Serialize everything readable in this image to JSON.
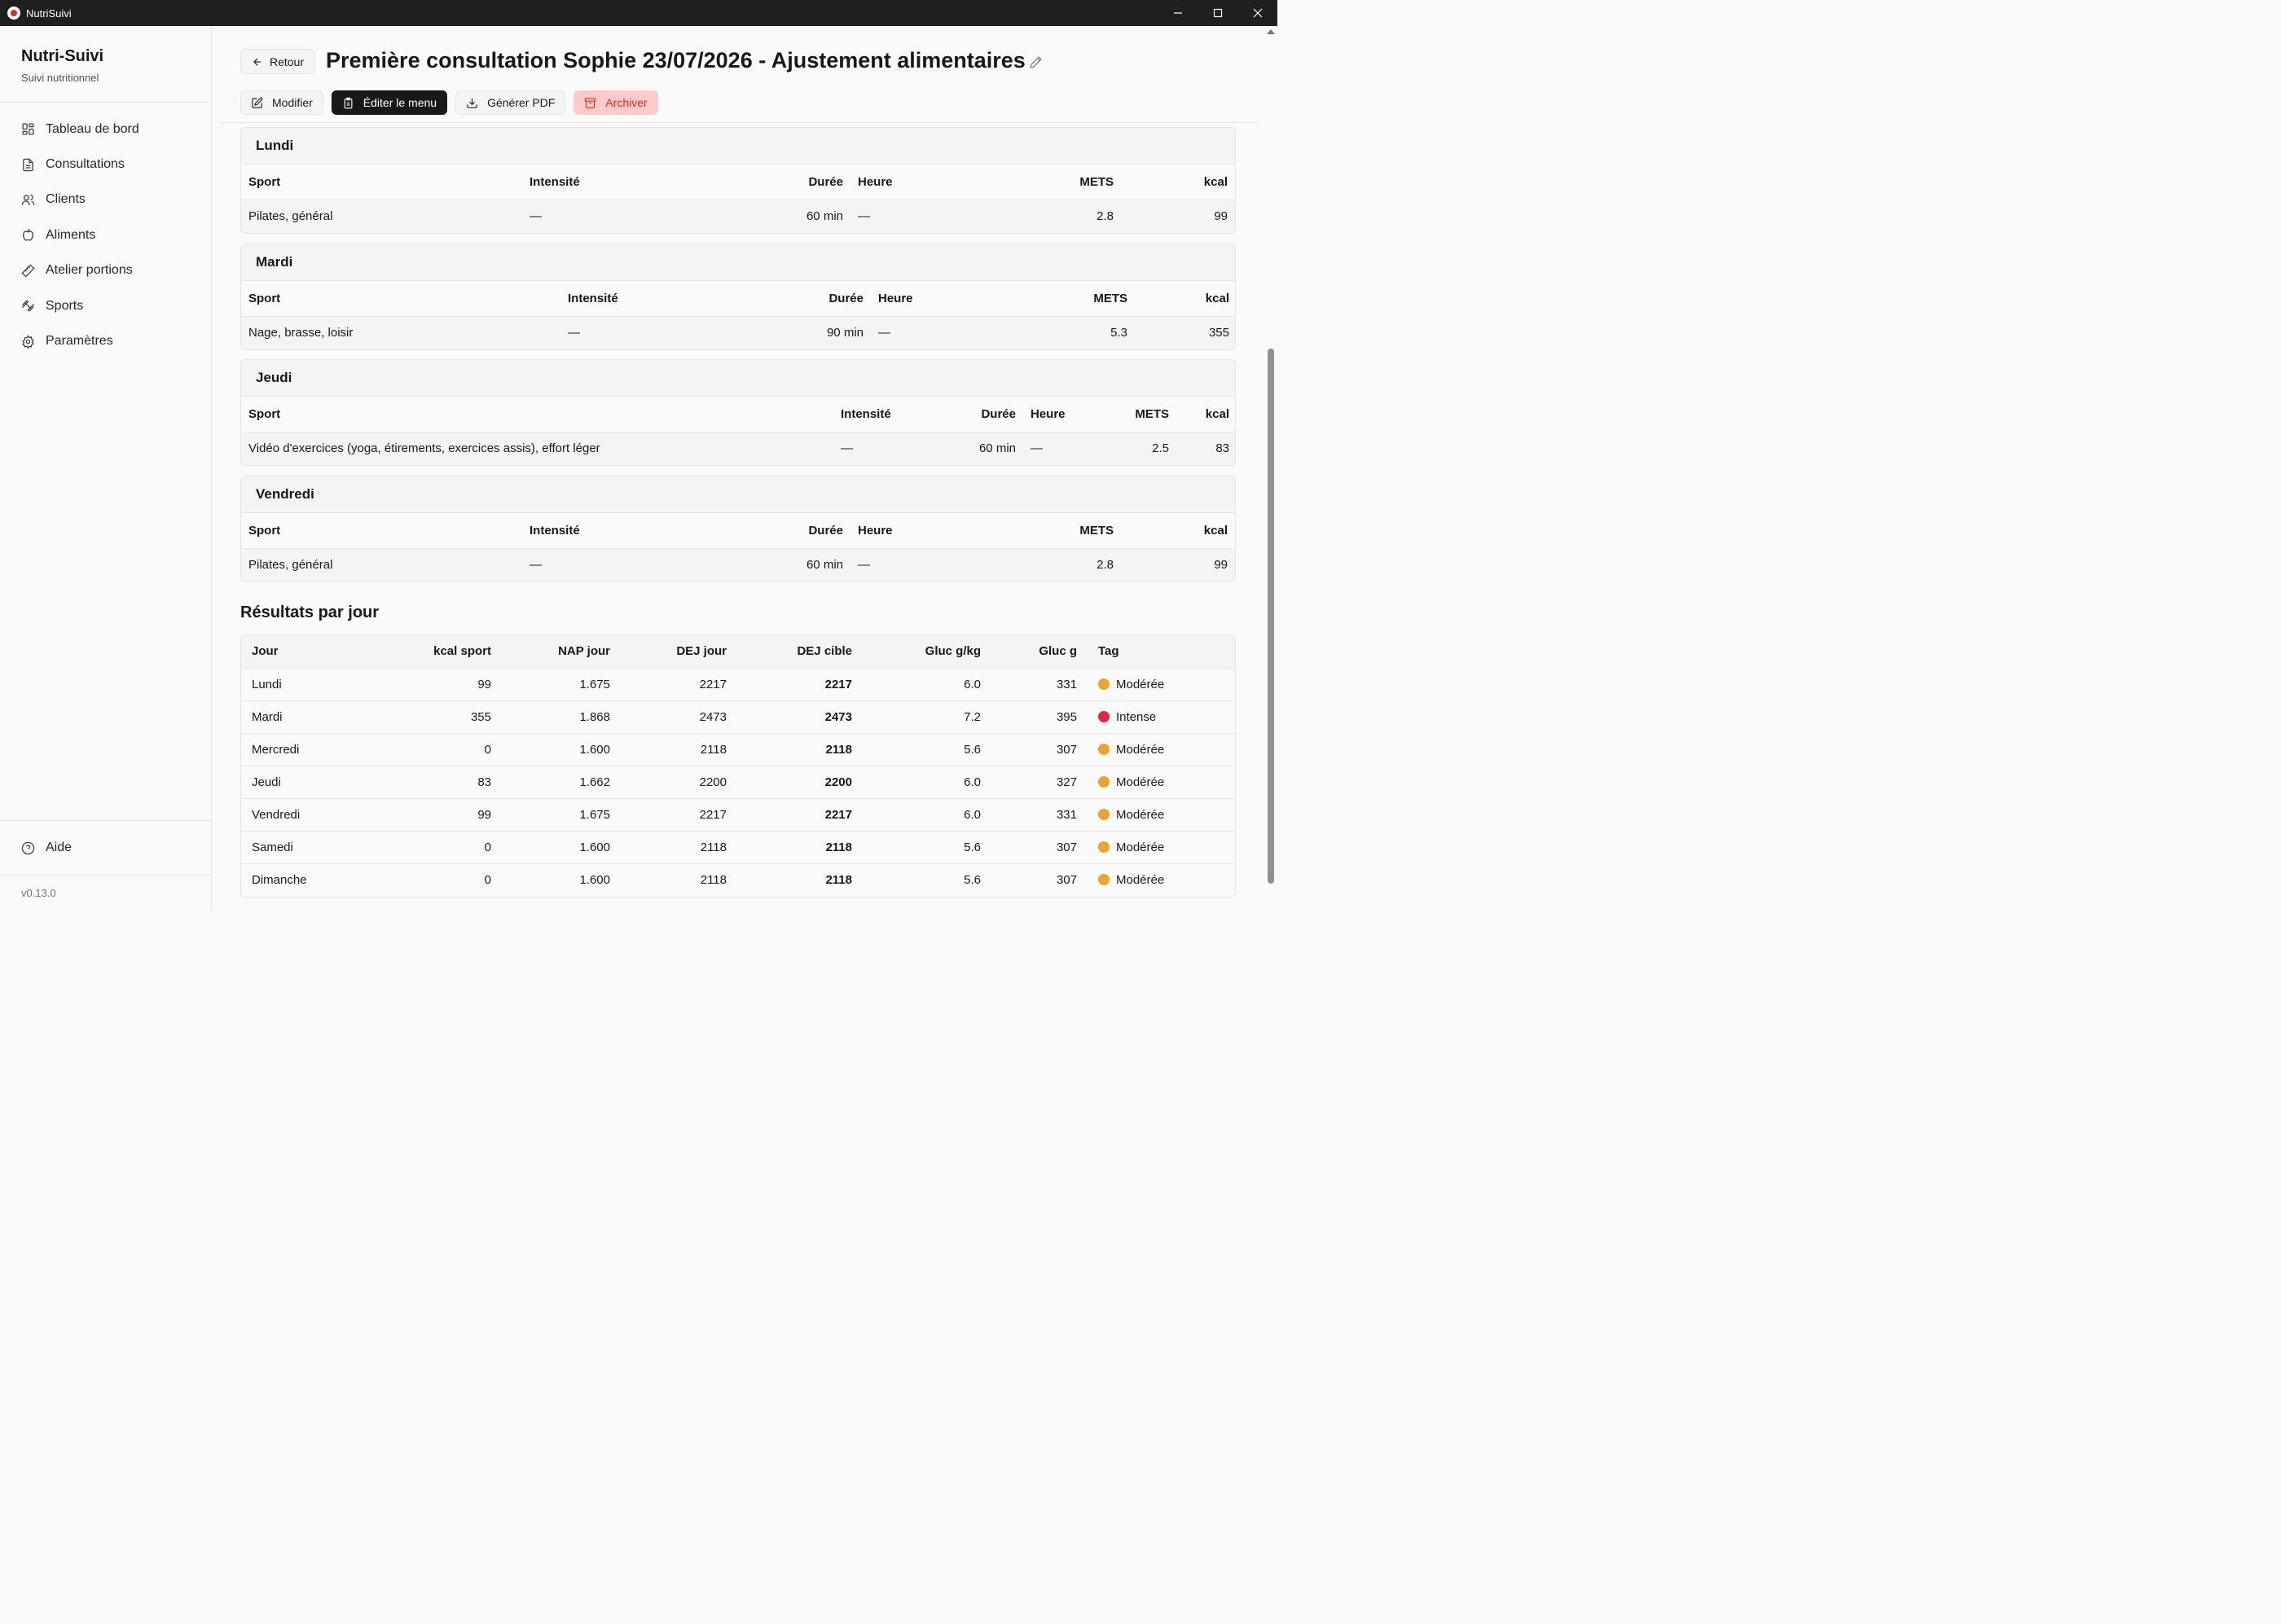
{
  "window": {
    "title": "NutriSuivi"
  },
  "sidebar": {
    "brand": "Nutri-Suivi",
    "subtitle": "Suivi nutritionnel",
    "items": [
      {
        "label": "Tableau de bord",
        "icon": "dashboard-icon"
      },
      {
        "label": "Consultations",
        "icon": "document-icon"
      },
      {
        "label": "Clients",
        "icon": "users-icon"
      },
      {
        "label": "Aliments",
        "icon": "apple-icon"
      },
      {
        "label": "Atelier portions",
        "icon": "ruler-icon"
      },
      {
        "label": "Sports",
        "icon": "dumbbell-icon"
      },
      {
        "label": "Paramètres",
        "icon": "gear-icon"
      }
    ],
    "help": "Aide",
    "version": "v0.13.0"
  },
  "header": {
    "back": "Retour",
    "title": "Première consultation Sophie 23/07/2026 - Ajustement alimentaires",
    "actions": {
      "modify": "Modifier",
      "edit_menu": "Éditer le menu",
      "pdf": "Générer PDF",
      "archive": "Archiver"
    }
  },
  "sport_columns": {
    "sport": "Sport",
    "intensity": "Intensité",
    "duration": "Durée",
    "hour": "Heure",
    "mets": "METS",
    "kcal": "kcal"
  },
  "days": [
    {
      "name": "Lundi",
      "rows": [
        {
          "sport": "Pilates, général",
          "intensity": "—",
          "duration": "60 min",
          "hour": "—",
          "mets": "2.8",
          "kcal": "99"
        }
      ]
    },
    {
      "name": "Mardi",
      "rows": [
        {
          "sport": "Nage, brasse, loisir",
          "intensity": "—",
          "duration": "90 min",
          "hour": "—",
          "mets": "5.3",
          "kcal": "355"
        }
      ]
    },
    {
      "name": "Jeudi",
      "rows": [
        {
          "sport": "Vidéo d'exercices (yoga, étirements, exercices assis), effort léger",
          "intensity": "—",
          "duration": "60 min",
          "hour": "—",
          "mets": "2.5",
          "kcal": "83"
        }
      ]
    },
    {
      "name": "Vendredi",
      "rows": [
        {
          "sport": "Pilates, général",
          "intensity": "—",
          "duration": "60 min",
          "hour": "—",
          "mets": "2.8",
          "kcal": "99"
        }
      ]
    }
  ],
  "results": {
    "title": "Résultats par jour",
    "columns": {
      "day": "Jour",
      "kcal_sport": "kcal sport",
      "nap": "NAP jour",
      "dej": "DEJ jour",
      "dej_target": "DEJ cible",
      "gluc_kg": "Gluc g/kg",
      "gluc": "Gluc g",
      "tag": "Tag"
    },
    "tag_colors": {
      "Modérée": "#e9a531",
      "Intense": "#dc2645"
    },
    "rows": [
      {
        "day": "Lundi",
        "kcal_sport": "99",
        "nap": "1.675",
        "dej": "2217",
        "dej_target": "2217",
        "gluc_kg": "6.0",
        "gluc": "331",
        "tag": "Modérée"
      },
      {
        "day": "Mardi",
        "kcal_sport": "355",
        "nap": "1.868",
        "dej": "2473",
        "dej_target": "2473",
        "gluc_kg": "7.2",
        "gluc": "395",
        "tag": "Intense"
      },
      {
        "day": "Mercredi",
        "kcal_sport": "0",
        "nap": "1.600",
        "dej": "2118",
        "dej_target": "2118",
        "gluc_kg": "5.6",
        "gluc": "307",
        "tag": "Modérée"
      },
      {
        "day": "Jeudi",
        "kcal_sport": "83",
        "nap": "1.662",
        "dej": "2200",
        "dej_target": "2200",
        "gluc_kg": "6.0",
        "gluc": "327",
        "tag": "Modérée"
      },
      {
        "day": "Vendredi",
        "kcal_sport": "99",
        "nap": "1.675",
        "dej": "2217",
        "dej_target": "2217",
        "gluc_kg": "6.0",
        "gluc": "331",
        "tag": "Modérée"
      },
      {
        "day": "Samedi",
        "kcal_sport": "0",
        "nap": "1.600",
        "dej": "2118",
        "dej_target": "2118",
        "gluc_kg": "5.6",
        "gluc": "307",
        "tag": "Modérée"
      },
      {
        "day": "Dimanche",
        "kcal_sport": "0",
        "nap": "1.600",
        "dej": "2118",
        "dej_target": "2118",
        "gluc_kg": "5.6",
        "gluc": "307",
        "tag": "Modérée"
      }
    ]
  }
}
